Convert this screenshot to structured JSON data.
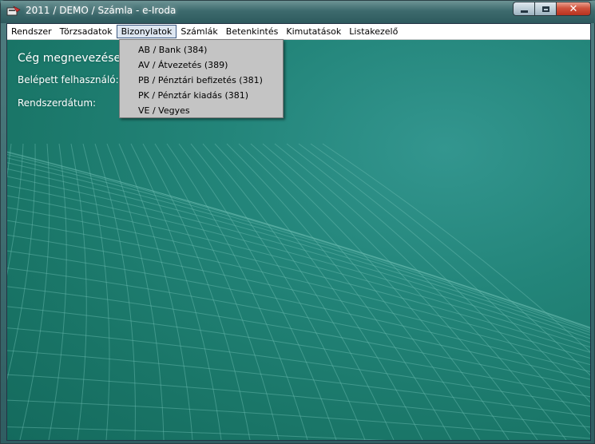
{
  "window": {
    "title": "2011 / DEMO / Számla - e-Iroda",
    "close_glyph": "✕"
  },
  "menubar": {
    "items": [
      "Rendszer",
      "Törzsadatok",
      "Bizonylatok",
      "Számlák",
      "Betenkintés",
      "Kimutatások",
      "Listakezelő"
    ],
    "open_item": "Bizonylatok"
  },
  "dropdown": {
    "items": [
      "AB / Bank (384)",
      "AV / Átvezetés (389)",
      "PB / Pénztári befizetés (381)",
      "PK / Pénztár kiadás (381)",
      "VE / Vegyes"
    ]
  },
  "info": {
    "company_label": "Cég megnevezése:",
    "user_label": "Belépett felhasználó:",
    "date_label": "Rendszerdátum:"
  },
  "icons": {
    "app": "app-icon",
    "minimize": "minimize-icon",
    "maximize": "maximize-icon",
    "close": "close-icon"
  },
  "colors": {
    "background_teal": "#1f7f72",
    "menu_highlight": "#dde6f1",
    "dropdown_bg": "#c4c4c4"
  }
}
